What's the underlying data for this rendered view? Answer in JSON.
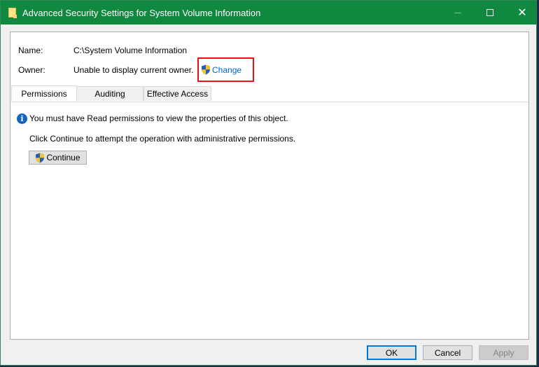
{
  "window": {
    "title": "Advanced Security Settings for System Volume Information",
    "controls": {
      "minimize": "—",
      "maximize": "□",
      "close": "✕"
    }
  },
  "details": {
    "name_label": "Name:",
    "name_value": "C:\\System Volume Information",
    "owner_label": "Owner:",
    "owner_value": "Unable to display current owner.",
    "change_link": "Change",
    "highlight_color": "#e81010"
  },
  "tabs": [
    {
      "label": "Permissions",
      "active": true
    },
    {
      "label": "Auditing",
      "active": false
    },
    {
      "label": "Effective Access",
      "active": false
    }
  ],
  "permissions_tab": {
    "info_icon_glyph": "i",
    "info_message": "You must have Read permissions to view the properties of this object.",
    "continue_hint": "Click Continue to attempt the operation with administrative permissions.",
    "continue_button": "Continue"
  },
  "footer": {
    "ok": "OK",
    "cancel": "Cancel",
    "apply": "Apply",
    "apply_disabled": true
  },
  "colors": {
    "titlebar": "#118840",
    "link": "#0066cc",
    "focus": "#0078d7"
  }
}
